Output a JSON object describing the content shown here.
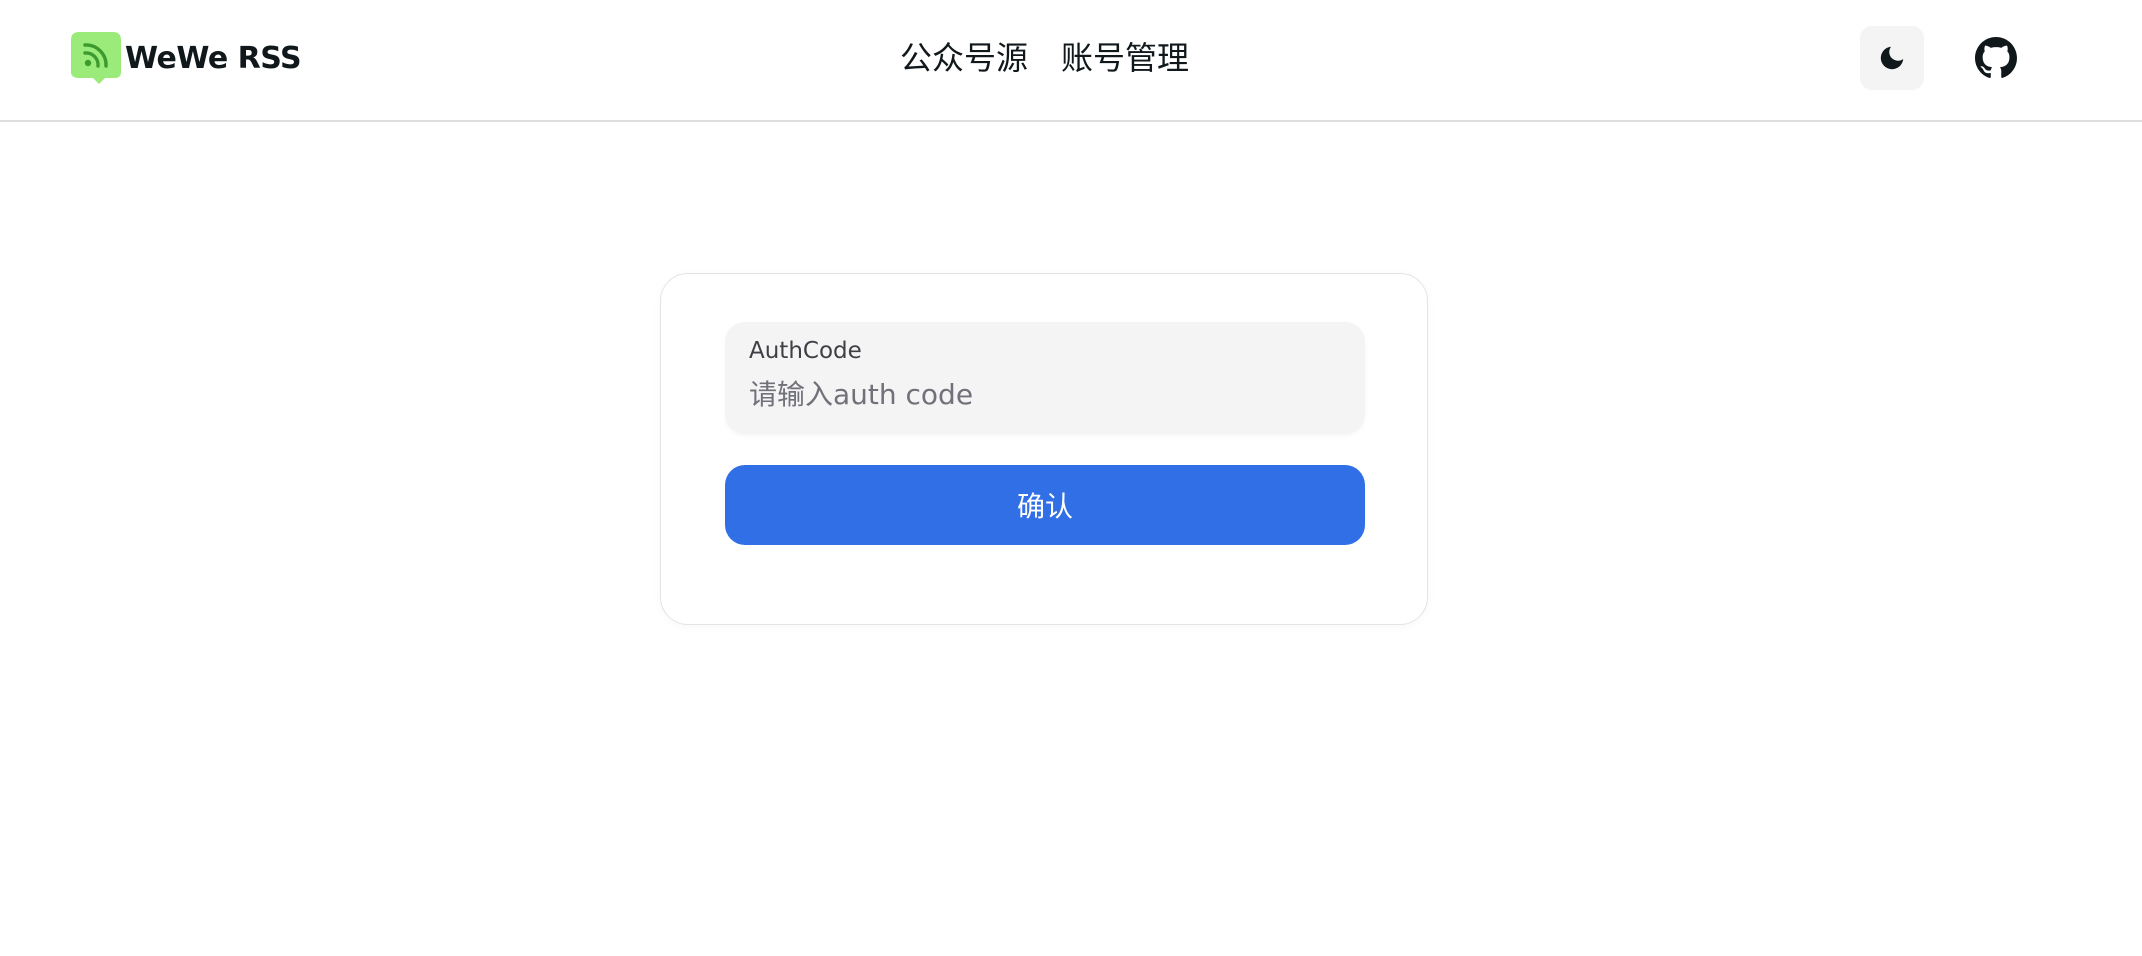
{
  "brand": {
    "name": "WeWe RSS",
    "logo_icon": "rss-chat-bubble-icon",
    "logo_color": "#9aeb7a"
  },
  "nav": {
    "items": [
      {
        "label": "公众号源"
      },
      {
        "label": "账号管理"
      }
    ]
  },
  "header_actions": {
    "theme_toggle_icon": "moon-icon",
    "github_icon": "github-icon"
  },
  "form": {
    "auth_code": {
      "label": "AuthCode",
      "value": "",
      "placeholder": "请输入auth code"
    },
    "submit_label": "确认"
  },
  "colors": {
    "primary": "#306fe6",
    "input_bg": "#f4f4f5"
  }
}
